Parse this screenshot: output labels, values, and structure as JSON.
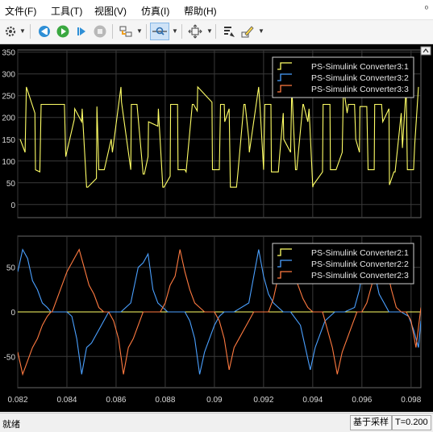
{
  "menu": [
    {
      "id": "file",
      "label": "文件(F)"
    },
    {
      "id": "tools",
      "label": "工具(T)"
    },
    {
      "id": "view",
      "label": "视图(V)"
    },
    {
      "id": "simulation",
      "label": "仿真(I)"
    },
    {
      "id": "help",
      "label": "帮助(H)"
    }
  ],
  "pin_glyph": "ᵒ",
  "toolbar_icons": [
    "settings-icon",
    "stop-back-icon",
    "run-icon",
    "step-forward-icon",
    "stop-icon",
    "highlight-icon",
    "zoom-x-icon",
    "autoscale-icon",
    "cursor-measure-icon",
    "style-icon"
  ],
  "plot1": {
    "yticks": [
      "350",
      "300",
      "250",
      "200",
      "150",
      "100",
      "50",
      "0"
    ],
    "legend": [
      {
        "label": "PS-Simulink Converter3:1",
        "color": "#ffff66"
      },
      {
        "label": "PS-Simulink Converter3:2",
        "color": "#4aa0ff"
      },
      {
        "label": "PS-Simulink Converter3:3",
        "color": "#ff7a40"
      }
    ]
  },
  "plot2": {
    "yticks": [
      "50",
      "0",
      "-50"
    ],
    "legend": [
      {
        "label": "PS-Simulink Converter2:1",
        "color": "#ffff66"
      },
      {
        "label": "PS-Simulink Converter2:2",
        "color": "#4aa0ff"
      },
      {
        "label": "PS-Simulink Converter2:3",
        "color": "#ff7a40"
      }
    ]
  },
  "xticks": [
    "0.082",
    "0.084",
    "0.086",
    "0.088",
    "0.09",
    "0.092",
    "0.094",
    "0.096",
    "0.098"
  ],
  "status": {
    "left": "就绪",
    "sample": "基于采样",
    "time": "T=0.200"
  },
  "chart_data": [
    {
      "type": "line",
      "title": "",
      "xlim": [
        0.082,
        0.0984
      ],
      "ylim": [
        -30,
        355
      ],
      "series": [
        {
          "name": "PS-Simulink Converter3:1",
          "color": "#ffff66",
          "x": [
            0.0821,
            0.0823,
            0.08235,
            0.0827,
            0.08272,
            0.0829,
            0.08295,
            0.0831,
            0.08312,
            0.0839,
            0.08395,
            0.0843,
            0.08432,
            0.0846,
            0.08462,
            0.0848,
            0.08485,
            0.0852,
            0.08522,
            0.0853,
            0.08535,
            0.0855,
            0.08552,
            0.0858,
            0.08585,
            0.0862,
            0.08622,
            0.0866,
            0.08662,
            0.0868,
            0.08685,
            0.0871,
            0.08715,
            0.0873,
            0.08732,
            0.0877,
            0.08772,
            0.0879,
            0.08795,
            0.0882,
            0.08822,
            0.0885,
            0.08852,
            0.0888,
            0.08885,
            0.0891,
            0.08915,
            0.0893,
            0.08932,
            0.0899,
            0.08992,
            0.0902,
            0.09025,
            0.0904,
            0.09042,
            0.0906,
            0.09065,
            0.0909,
            0.09095,
            0.0912,
            0.09125,
            0.0914,
            0.09142,
            0.0918,
            0.09185,
            0.092,
            0.09205,
            0.0923,
            0.09232,
            0.0926,
            0.09265,
            0.0928,
            0.09282,
            0.0931,
            0.09315,
            0.0933,
            0.09335,
            0.0936,
            0.09362,
            0.0938,
            0.09385,
            0.094,
            0.09402,
            0.0944,
            0.09442,
            0.0947,
            0.09472,
            0.0949,
            0.09495,
            0.0952,
            0.09525,
            0.0954,
            0.09545,
            0.0957,
            0.09575,
            0.0959,
            0.09592,
            0.0962,
            0.09625,
            0.0965,
            0.09652,
            0.0968,
            0.09685,
            0.0971,
            0.09712,
            0.0973,
            0.09735,
            0.0976,
            0.09765,
            0.0978,
            0.09785,
            0.0981,
            0.09815,
            0.0983
          ],
          "y": [
            150,
            120,
            270,
            210,
            80,
            75,
            230,
            230,
            230,
            230,
            110,
            195,
            220,
            190,
            220,
            40,
            40,
            60,
            225,
            80,
            80,
            80,
            80,
            150,
            120,
            270,
            235,
            80,
            230,
            230,
            230,
            70,
            70,
            110,
            190,
            180,
            220,
            40,
            40,
            65,
            230,
            230,
            80,
            80,
            75,
            230,
            230,
            215,
            270,
            235,
            80,
            80,
            230,
            230,
            190,
            220,
            40,
            40,
            70,
            230,
            230,
            150,
            120,
            270,
            230,
            80,
            230,
            230,
            75,
            75,
            110,
            210,
            150,
            120,
            270,
            80,
            80,
            230,
            230,
            190,
            220,
            40,
            45,
            75,
            230,
            230,
            80,
            80,
            80,
            120,
            270,
            210,
            230,
            230,
            150,
            120,
            225,
            225,
            80,
            80,
            230,
            230,
            190,
            220,
            45,
            75,
            75,
            210,
            130,
            270,
            80,
            80,
            140,
            270
          ]
        },
        {
          "name": "PS-Simulink Converter3:2",
          "color": "#4aa0ff",
          "x": [],
          "y": []
        },
        {
          "name": "PS-Simulink Converter3:3",
          "color": "#ff7a40",
          "x": [],
          "y": []
        }
      ]
    },
    {
      "type": "line",
      "title": "",
      "xlim": [
        0.082,
        0.0984
      ],
      "ylim": [
        -85,
        85
      ],
      "series": [
        {
          "name": "PS-Simulink Converter2:1",
          "color": "#ffff66",
          "x": [
            0.082,
            0.0984
          ],
          "y": [
            0,
            0
          ]
        },
        {
          "name": "PS-Simulink Converter2:2",
          "color": "#4aa0ff",
          "x": [
            0.082,
            0.0822,
            0.0824,
            0.0826,
            0.0828,
            0.083,
            0.0832,
            0.08335,
            0.0834,
            0.084,
            0.0842,
            0.0844,
            0.0846,
            0.0848,
            0.085,
            0.0852,
            0.0854,
            0.0856,
            0.0857,
            0.0862,
            0.0866,
            0.0869,
            0.0871,
            0.0873,
            0.0875,
            0.0877,
            0.0879,
            0.0881,
            0.0882,
            0.0888,
            0.089,
            0.0892,
            0.0894,
            0.0896,
            0.0898,
            0.09,
            0.0902,
            0.0904,
            0.0906,
            0.0908,
            0.0914,
            0.0916,
            0.0918,
            0.092,
            0.0922,
            0.0924,
            0.0926,
            0.0928,
            0.0929,
            0.0931,
            0.0935,
            0.0937,
            0.0939,
            0.0941,
            0.0943,
            0.0945,
            0.0947,
            0.0949,
            0.0951,
            0.0953,
            0.0957,
            0.0959,
            0.0961,
            0.0963,
            0.0965,
            0.0967,
            0.0969,
            0.0971,
            0.0973,
            0.0975,
            0.0976,
            0.0979,
            0.0981,
            0.0983,
            0.0984
          ],
          "y": [
            45,
            70,
            60,
            35,
            25,
            10,
            5,
            0,
            0,
            0,
            -5,
            -30,
            -70,
            -40,
            -35,
            -25,
            -15,
            -5,
            0,
            0,
            10,
            50,
            55,
            65,
            25,
            10,
            5,
            0,
            0,
            0,
            -10,
            -30,
            -70,
            -45,
            -30,
            -15,
            -5,
            0,
            0,
            0,
            10,
            40,
            70,
            40,
            20,
            10,
            5,
            0,
            0,
            0,
            -15,
            -40,
            -65,
            -40,
            -25,
            -10,
            -5,
            0,
            0,
            0,
            5,
            25,
            60,
            65,
            45,
            20,
            10,
            0,
            0,
            0,
            0,
            -5,
            -20,
            -40,
            -10
          ]
        },
        {
          "name": "PS-Simulink Converter2:3",
          "color": "#ff7a40",
          "x": [
            0.082,
            0.0822,
            0.0824,
            0.0826,
            0.0828,
            0.083,
            0.0832,
            0.08335,
            0.0834,
            0.0836,
            0.0838,
            0.084,
            0.0843,
            0.0845,
            0.0847,
            0.0849,
            0.0851,
            0.0853,
            0.0855,
            0.0857,
            0.0859,
            0.0861,
            0.0863,
            0.0865,
            0.0867,
            0.0869,
            0.0871,
            0.0878,
            0.088,
            0.0882,
            0.0884,
            0.0886,
            0.0888,
            0.089,
            0.0892,
            0.0894,
            0.0896,
            0.0898,
            0.09,
            0.0902,
            0.0904,
            0.0906,
            0.0908,
            0.091,
            0.0912,
            0.0914,
            0.0916,
            0.0918,
            0.092,
            0.0922,
            0.0924,
            0.0926,
            0.0928,
            0.093,
            0.0932,
            0.0934,
            0.0936,
            0.0938,
            0.094,
            0.0942,
            0.0944,
            0.0946,
            0.0948,
            0.095,
            0.0952,
            0.0954,
            0.0956,
            0.0958,
            0.096,
            0.0962,
            0.0964,
            0.0966,
            0.0968,
            0.097,
            0.0972,
            0.0974,
            0.0976,
            0.0978,
            0.098,
            0.0982,
            0.0984
          ],
          "y": [
            -45,
            -70,
            -55,
            -40,
            -30,
            -15,
            -5,
            0,
            0,
            15,
            30,
            45,
            60,
            70,
            50,
            30,
            20,
            5,
            0,
            0,
            -10,
            -30,
            -70,
            -40,
            -30,
            -15,
            0,
            0,
            10,
            30,
            40,
            70,
            45,
            25,
            10,
            5,
            0,
            0,
            0,
            -10,
            -30,
            -65,
            -40,
            -30,
            -20,
            -10,
            0,
            0,
            0,
            0,
            15,
            40,
            60,
            65,
            45,
            30,
            15,
            5,
            0,
            0,
            0,
            -20,
            -40,
            -70,
            -45,
            -30,
            -15,
            0,
            0,
            10,
            30,
            55,
            65,
            50,
            25,
            5,
            0,
            0,
            -10,
            -40,
            5
          ]
        }
      ]
    }
  ]
}
